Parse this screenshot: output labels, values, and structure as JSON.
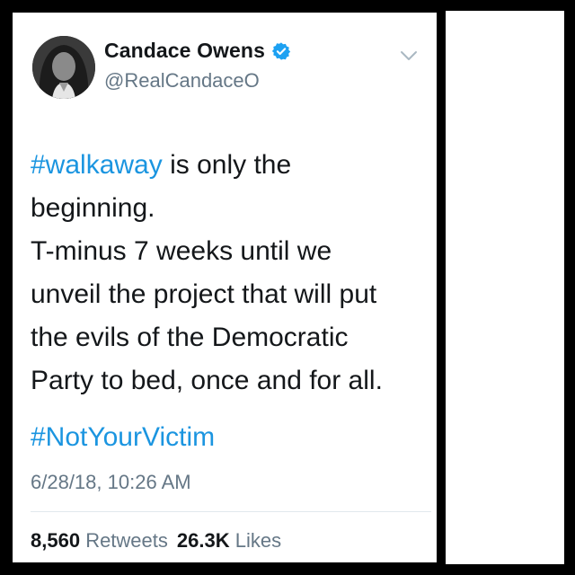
{
  "tweet": {
    "display_name": "Candace Owens",
    "handle": "@RealCandaceO",
    "verified": true,
    "text_lines": [
      {
        "hashtag": "#walkaway",
        "rest": " is only the"
      },
      {
        "text": "beginning."
      },
      {
        "text": "T-minus 7 weeks until we"
      },
      {
        "text": "unveil the project that will put"
      },
      {
        "text": "the evils of the Democratic"
      },
      {
        "text": "Party to bed, once and for all."
      }
    ],
    "hashtag_line": "#NotYourVictim",
    "timestamp": "6/28/18, 10:26 AM",
    "stats": {
      "retweets_count": "8,560",
      "retweets_label": "Retweets",
      "likes_count": "26.3K",
      "likes_label": "Likes"
    }
  },
  "icons": {
    "verified": "verified-badge-icon",
    "menu": "chevron-down-icon"
  },
  "colors": {
    "link": "#1b95e0",
    "text": "#14171a",
    "secondary": "#657786",
    "verified": "#1da1f2",
    "background_outer": "#000000",
    "card": "#ffffff"
  }
}
